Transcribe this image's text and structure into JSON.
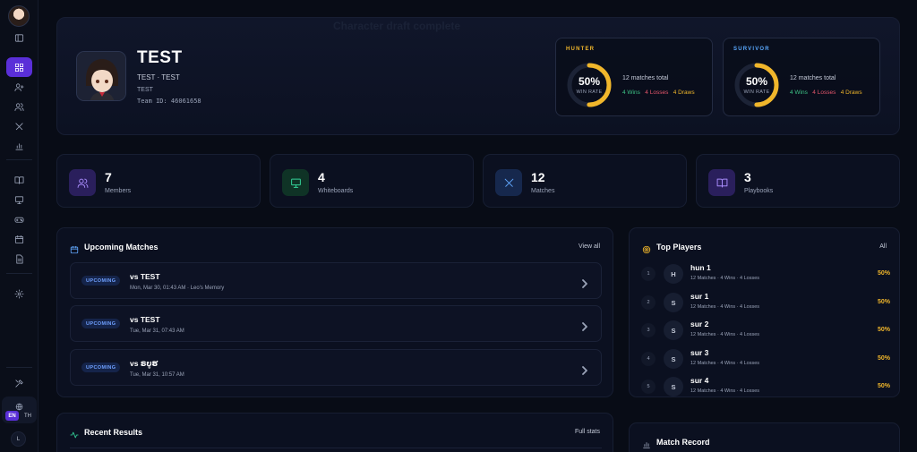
{
  "sidebar": {
    "icons": [
      {
        "name": "sidebar-toggle-icon",
        "top": 0
      },
      {
        "name": "dashboard-icon"
      },
      {
        "name": "add-user-icon"
      },
      {
        "name": "users-icon"
      },
      {
        "name": "swords-icon"
      },
      {
        "name": "bar-chart-icon"
      },
      {
        "name": "book-icon"
      },
      {
        "name": "whiteboard-icon"
      },
      {
        "name": "gamepad-icon"
      },
      {
        "name": "calendar-icon"
      },
      {
        "name": "document-icon"
      },
      {
        "name": "settings-icon"
      }
    ],
    "active": "dashboard-icon",
    "bottom_icon": "tools-icon",
    "lang": {
      "en": "EN",
      "th": "TH"
    },
    "user_initial": "L"
  },
  "hero": {
    "name": "TEST",
    "subtitle": "TEST · TEST",
    "tag": "TEST",
    "team_id": "Team ID: 46061658",
    "ghost_text": "Character draft complete",
    "roles": [
      {
        "title": "HUNTER",
        "win_rate": "50%",
        "win_rate_value": 0.5,
        "win_rate_label": "WIN RATE",
        "total": "12 matches total",
        "wins": "4 Wins",
        "losses": "4 Losses",
        "draws": "4 Draws"
      },
      {
        "title": "SURVIVOR",
        "win_rate": "50%",
        "win_rate_value": 0.5,
        "win_rate_label": "WIN RATE",
        "total": "12 matches total",
        "wins": "4 Wins",
        "losses": "4 Losses",
        "draws": "4 Draws"
      }
    ],
    "colors": {
      "hunter": "#f0b62b",
      "survivor": "#5aa9ff",
      "ring": "#f0b62b"
    }
  },
  "stats": [
    {
      "value": "7",
      "label": "Members",
      "icon": "users-icon",
      "color": "#a78bfa",
      "bg": "#2a1f5c"
    },
    {
      "value": "4",
      "label": "Whiteboards",
      "icon": "whiteboard-icon",
      "color": "#34d399",
      "bg": "#0f3326"
    },
    {
      "value": "12",
      "label": "Matches",
      "icon": "swords-icon",
      "color": "#60a5fa",
      "bg": "#16284d"
    },
    {
      "value": "3",
      "label": "Playbooks",
      "icon": "book-icon",
      "color": "#a78bfa",
      "bg": "#2a1f5c"
    }
  ],
  "upcoming": {
    "title": "Upcoming Matches",
    "link": "View all",
    "items": [
      {
        "badge": "UPCOMING",
        "title": "vs TEST",
        "meta": "Mon, Mar 30, 01:43 AM · Leo's Memory"
      },
      {
        "badge": "UPCOMING",
        "title": "vs TEST",
        "meta": "Tue, Mar 31, 07:43 AM"
      },
      {
        "badge": "UPCOMING",
        "title": "vs ຣບູຮ",
        "meta": "Tue, Mar 31, 10:57 AM"
      }
    ]
  },
  "top_players": {
    "title": "Top Players",
    "link": "All",
    "players": [
      {
        "rank": "1",
        "initial": "H",
        "name": "hun 1",
        "meta": "12 Matches · 4 Wins · 4 Losses",
        "rate": "50%"
      },
      {
        "rank": "2",
        "initial": "S",
        "name": "sur 1",
        "meta": "12 Matches · 4 Wins · 4 Losses",
        "rate": "50%"
      },
      {
        "rank": "3",
        "initial": "S",
        "name": "sur 2",
        "meta": "12 Matches · 4 Wins · 4 Losses",
        "rate": "50%"
      },
      {
        "rank": "4",
        "initial": "S",
        "name": "sur 3",
        "meta": "12 Matches · 4 Wins · 4 Losses",
        "rate": "50%"
      },
      {
        "rank": "5",
        "initial": "S",
        "name": "sur 4",
        "meta": "12 Matches · 4 Wins · 4 Losses",
        "rate": "50%"
      }
    ]
  },
  "recent": {
    "title": "Recent Results",
    "link": "Full stats"
  },
  "record": {
    "title": "Match Record"
  }
}
